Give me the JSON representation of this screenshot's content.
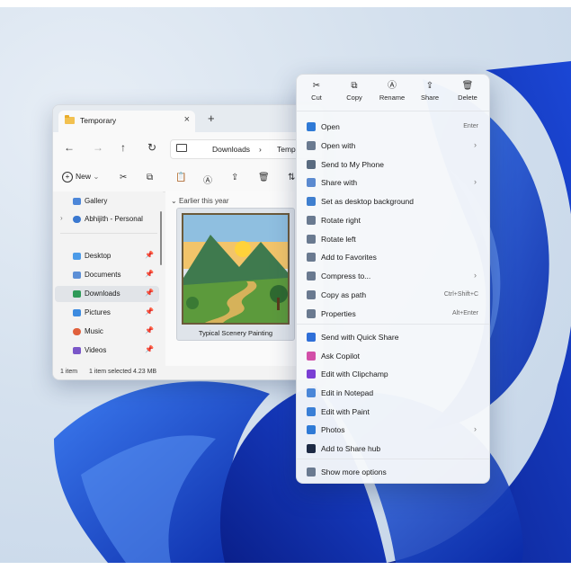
{
  "explorer": {
    "tab_title": "Temporary",
    "tab_close": "×",
    "new_tab": "+",
    "nav": {
      "back": "←",
      "forward": "→",
      "up": "↑",
      "refresh": "↻"
    },
    "breadcrumb": [
      "Downloads",
      "Temp"
    ],
    "breadcrumb_sep": "›",
    "new_label": "New",
    "sidebar": [
      {
        "label": "Gallery",
        "color": "#4c86d8",
        "pinned": false,
        "expand": false,
        "active": false
      },
      {
        "label": "Abhijith - Personal",
        "color": "#3a78d0",
        "pinned": false,
        "expand": true,
        "active": false
      },
      {
        "label": "Desktop",
        "color": "#4c9be8",
        "pinned": true,
        "expand": false,
        "active": false
      },
      {
        "label": "Documents",
        "color": "#5c8fd6",
        "pinned": true,
        "expand": false,
        "active": false
      },
      {
        "label": "Downloads",
        "color": "#2e9a58",
        "pinned": true,
        "expand": false,
        "active": true
      },
      {
        "label": "Pictures",
        "color": "#3d8be0",
        "pinned": true,
        "expand": false,
        "active": false
      },
      {
        "label": "Music",
        "color": "#e0603c",
        "pinned": true,
        "expand": false,
        "active": false
      },
      {
        "label": "Videos",
        "color": "#7a56c8",
        "pinned": true,
        "expand": false,
        "active": false
      }
    ],
    "group_label": "Earlier this year",
    "file_name": "Typical Scenery Painting",
    "status": {
      "count": "1 item",
      "selected": "1 item selected  4.23 MB"
    }
  },
  "context_menu": {
    "quick_actions": [
      {
        "label": "Cut",
        "icon": "scissors-icon",
        "glyph": "✂"
      },
      {
        "label": "Copy",
        "icon": "copy-icon",
        "glyph": "⧉"
      },
      {
        "label": "Rename",
        "icon": "rename-icon",
        "glyph": "Ⓐ"
      },
      {
        "label": "Share",
        "icon": "share-icon",
        "glyph": "⇪"
      },
      {
        "label": "Delete",
        "icon": "trash-icon",
        "glyph": "🗑"
      }
    ],
    "items": [
      {
        "label": "Open",
        "shortcut": "Enter",
        "submenu": false,
        "icon": "image-icon",
        "color": "#2f7ad6"
      },
      {
        "label": "Open with",
        "shortcut": "",
        "submenu": true,
        "icon": "open-with-icon",
        "color": "#6a7a90"
      },
      {
        "label": "Send to My Phone",
        "shortcut": "",
        "submenu": false,
        "icon": "phone-icon",
        "color": "#5a6b80"
      },
      {
        "label": "Share with",
        "shortcut": "",
        "submenu": true,
        "icon": "share-with-icon",
        "color": "#5b8ad0"
      },
      {
        "label": "Set as desktop background",
        "shortcut": "",
        "submenu": false,
        "icon": "desktop-background-icon",
        "color": "#3f7fcf"
      },
      {
        "label": "Rotate right",
        "shortcut": "",
        "submenu": false,
        "icon": "rotate-right-icon",
        "color": "#6a7a90"
      },
      {
        "label": "Rotate left",
        "shortcut": "",
        "submenu": false,
        "icon": "rotate-left-icon",
        "color": "#6a7a90"
      },
      {
        "label": "Add to Favorites",
        "shortcut": "",
        "submenu": false,
        "icon": "star-icon",
        "color": "#6a7a90"
      },
      {
        "label": "Compress to...",
        "shortcut": "",
        "submenu": true,
        "icon": "zip-icon",
        "color": "#6a7a90"
      },
      {
        "label": "Copy as path",
        "shortcut": "Ctrl+Shift+C",
        "submenu": false,
        "icon": "path-icon",
        "color": "#6a7a90"
      },
      {
        "label": "Properties",
        "shortcut": "Alt+Enter",
        "submenu": false,
        "icon": "wrench-icon",
        "color": "#6a7a90"
      },
      {
        "label": "Send with Quick Share",
        "shortcut": "",
        "submenu": false,
        "icon": "quick-share-icon",
        "color": "#2f6fd8"
      },
      {
        "label": "Ask Copilot",
        "shortcut": "",
        "submenu": false,
        "icon": "copilot-icon",
        "color": "#d24fa8"
      },
      {
        "label": "Edit with Clipchamp",
        "shortcut": "",
        "submenu": false,
        "icon": "clipchamp-icon",
        "color": "#7b3fd4"
      },
      {
        "label": "Edit in Notepad",
        "shortcut": "",
        "submenu": false,
        "icon": "notepad-icon",
        "color": "#4a86d8"
      },
      {
        "label": "Edit with Paint",
        "shortcut": "",
        "submenu": false,
        "icon": "paint-icon",
        "color": "#3a7fd6"
      },
      {
        "label": "Photos",
        "shortcut": "",
        "submenu": true,
        "icon": "photos-icon",
        "color": "#2f7ad6"
      },
      {
        "label": "Add to Share hub",
        "shortcut": "",
        "submenu": false,
        "icon": "share-hub-icon",
        "color": "#1d2a44"
      },
      {
        "label": "Show more options",
        "shortcut": "",
        "submenu": false,
        "icon": "more-options-icon",
        "color": "#6a7a90"
      }
    ],
    "chevron": "›"
  }
}
